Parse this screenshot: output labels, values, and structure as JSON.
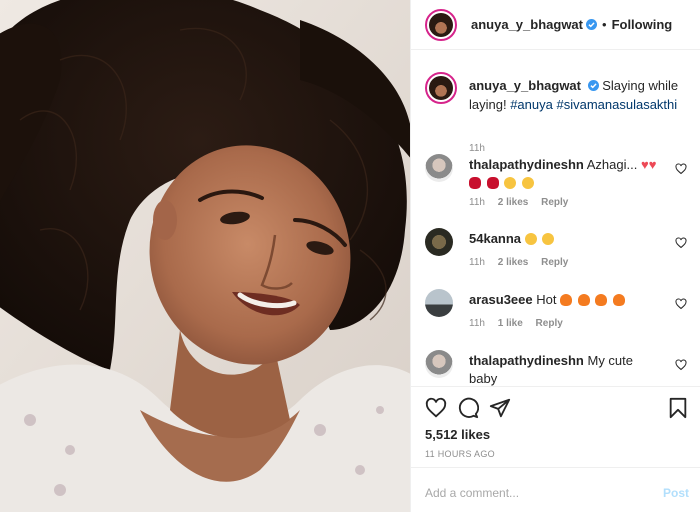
{
  "post": {
    "username": "anuya_y_bhagwat",
    "follow_label": "Following",
    "dot": "•"
  },
  "caption": {
    "username": "anuya_y_bhagwat",
    "text": "Slaying while laying!",
    "hashtag1": "#anuya",
    "hashtag2": "#sivamanasulasakthi",
    "time": "11h"
  },
  "comments": [
    {
      "user": "thalapathydineshn",
      "text": "Azhagi...",
      "time": "11h",
      "likes": "2 likes",
      "reply": "Reply"
    },
    {
      "user": "54kanna",
      "text": "",
      "time": "11h",
      "likes": "2 likes",
      "reply": "Reply"
    },
    {
      "user": "arasu3eee",
      "text": "Hot",
      "time": "11h",
      "likes": "1 like",
      "reply": "Reply"
    },
    {
      "user": "thalapathydineshn",
      "text": "My cute baby",
      "time": "",
      "likes": "",
      "reply": ""
    }
  ],
  "footer": {
    "likes": "5,512 likes",
    "ago": "11 HOURS AGO",
    "add_comment_placeholder": "Add a comment...",
    "post_label": "Post"
  },
  "icons": {
    "like": "heart-icon",
    "comment": "comment-icon",
    "share": "share-icon",
    "save": "bookmark-icon"
  },
  "colors": {
    "verified": "#3897f0",
    "link": "#00376b",
    "meta": "#8e8e8e",
    "post_disabled": "#b2dffc",
    "heart_red": "#ed4956"
  }
}
